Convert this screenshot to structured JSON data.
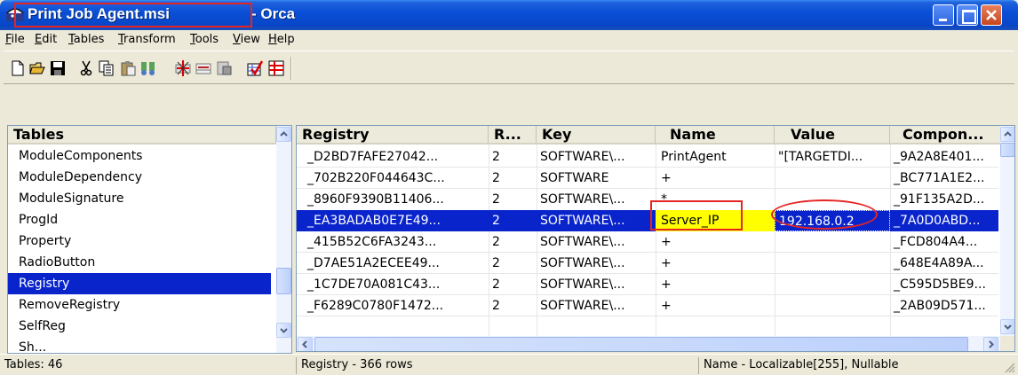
{
  "window": {
    "file_title": "Print Job Agent.msi",
    "app_title": "- Orca"
  },
  "menu": [
    "File",
    "Edit",
    "Tables",
    "Transform",
    "Tools",
    "View",
    "Help"
  ],
  "toolbar_icons": [
    "new-icon",
    "open-icon",
    "save-icon",
    "cut-icon",
    "copy-icon",
    "paste-icon",
    "find-icon",
    "add-row-icon",
    "drop-row-icon",
    "table-icon",
    "validate-icon",
    "merge-icon"
  ],
  "tables_panel": {
    "header": "Tables",
    "items": [
      "ModuleComponents",
      "ModuleDependency",
      "ModuleSignature",
      "ProgId",
      "Property",
      "RadioButton",
      "Registry",
      "RemoveRegistry",
      "SelfReg",
      "Sh..."
    ],
    "selected": "Registry"
  },
  "grid": {
    "columns": [
      "Registry",
      "R...",
      "Key",
      "Name",
      "Value",
      "Compon..."
    ],
    "rows": [
      [
        "_D2BD7FAFE27042...",
        "2",
        "SOFTWARE\\...",
        "PrintAgent",
        "\"[TARGETDI...",
        "_9A2A8E401..."
      ],
      [
        "_702B220F044643C...",
        "2",
        "SOFTWARE",
        "+",
        "",
        "_BC771A1E2..."
      ],
      [
        "_8960F9390B11406...",
        "2",
        "SOFTWARE\\...",
        "*",
        "",
        "_91F135A2D..."
      ],
      [
        "_EA3BADAB0E7E49...",
        "2",
        "SOFTWARE\\...",
        "Server_IP",
        "192.168.0.2",
        "_7A0D0ABD..."
      ],
      [
        "_415B52C6FA3243...",
        "2",
        "SOFTWARE\\...",
        "+",
        "",
        "_FCD804A4..."
      ],
      [
        "_D7AE51A2ECEE49...",
        "2",
        "SOFTWARE\\...",
        "+",
        "",
        "_648E4A89A..."
      ],
      [
        "_1C7DE70A081C43...",
        "2",
        "SOFTWARE\\...",
        "+",
        "",
        "_C595D5BE9..."
      ],
      [
        "_F6289C0780F1472...",
        "2",
        "SOFTWARE\\...",
        "+",
        "",
        "_2AB09D571..."
      ]
    ],
    "selected_row": 3
  },
  "status": {
    "tables": "Tables: 46",
    "rows": "Registry - 366 rows",
    "column_info": "Name - Localizable[255], Nullable"
  },
  "colors": {
    "selection": "#0a24cc",
    "highlight": "#ffff00",
    "annotation": "#e52525"
  }
}
